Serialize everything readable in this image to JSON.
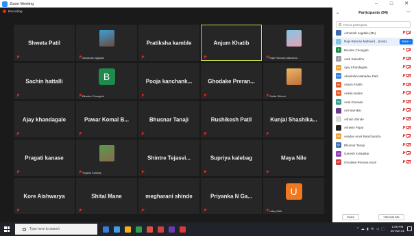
{
  "window": {
    "title": "Zoom Meeting",
    "controls": [
      "–",
      "□",
      "✕"
    ]
  },
  "recording": {
    "label": "Recording",
    "color": "#e02828"
  },
  "tiles": [
    {
      "name": "Shweta Patil",
      "label": "",
      "type": "name"
    },
    {
      "name": "",
      "label": "Ashutosh Jagdale",
      "type": "photo",
      "photo_colors": [
        "#3aa0d8",
        "#6b4a3a"
      ]
    },
    {
      "name": "Pratiksha kamble",
      "label": "",
      "type": "name"
    },
    {
      "name": "Anjum Khatib",
      "label": "",
      "type": "name",
      "active": true
    },
    {
      "name": "",
      "label": "Raje Ramrao Mahavid...",
      "type": "photo",
      "photo_colors": [
        "#7fc7e8",
        "#e8a0b0"
      ]
    },
    {
      "name": "Sachin hattalli",
      "label": "",
      "type": "name"
    },
    {
      "name": "",
      "label": "Birudev Chougule",
      "type": "letter",
      "letter": "B",
      "letter_color": "#1f8a4c"
    },
    {
      "name": "Pooja kanchank...",
      "label": "",
      "type": "name"
    },
    {
      "name": "Ghodake Preran...",
      "label": "",
      "type": "name"
    },
    {
      "name": "",
      "label": "Smita Shinde",
      "type": "photo",
      "photo_colors": [
        "#e8b860",
        "#c07040"
      ]
    },
    {
      "name": "Ajay khandagale",
      "label": "",
      "type": "name"
    },
    {
      "name": "Pawar Komal B...",
      "label": "",
      "type": "name"
    },
    {
      "name": "Bhusnar Tanaji",
      "label": "",
      "type": "name"
    },
    {
      "name": "Rushikesh Patil",
      "label": "",
      "type": "name"
    },
    {
      "name": "Kunjal Shashika...",
      "label": "",
      "type": "name"
    },
    {
      "name": "Pragati kanase",
      "label": "",
      "type": "name"
    },
    {
      "name": "",
      "label": "Yogesh Kolekar",
      "type": "photo",
      "photo_colors": [
        "#5a9a4a",
        "#8a6a50"
      ]
    },
    {
      "name": "Shintre Tejasvi...",
      "label": "",
      "type": "name"
    },
    {
      "name": "Supriya kalebag",
      "label": "",
      "type": "name"
    },
    {
      "name": "Maya Nile",
      "label": "",
      "type": "name"
    },
    {
      "name": "Kore Aishwarya",
      "label": "",
      "type": "name"
    },
    {
      "name": "Shital Mane",
      "label": "",
      "type": "name"
    },
    {
      "name": "megharani shinde",
      "label": "",
      "type": "name"
    },
    {
      "name": "Priyanka N Ga...",
      "label": "",
      "type": "name"
    },
    {
      "name": "",
      "label": "Uday Mali",
      "type": "letter",
      "letter": "U",
      "letter_color": "#f07820"
    }
  ],
  "participants_panel": {
    "title": "Participants (94)",
    "search_placeholder": "Find a participant",
    "more_button": "More ›",
    "invite_label": "Invite",
    "unmute_label": "Unmute Me",
    "participants": [
      {
        "name": "Ashutosh Jagdale (Me)",
        "initials": "",
        "color": "#3a6ab0",
        "mic": "muted",
        "video": "off"
      },
      {
        "name": "Raje Ramrao Mahavid... (Host)",
        "initials": "",
        "color": "#7fc7e8",
        "mic": "",
        "video": "",
        "highlight": true
      },
      {
        "name": "Birudev Chougule",
        "initials": "B",
        "color": "#1f8a4c",
        "mic": "grey",
        "video": "off"
      },
      {
        "name": "Aarti Salunkhe",
        "initials": "A",
        "color": "#9aa0a6",
        "mic": "muted",
        "video": "off"
      },
      {
        "name": "Ajay Khandagale",
        "initials": "AK",
        "color": "#f0a030",
        "mic": "muted",
        "video": "off"
      },
      {
        "name": "Akanksha Mahadev Patil",
        "initials": "AM",
        "color": "#2d7ad8",
        "mic": "muted",
        "video": "off"
      },
      {
        "name": "Anjum Khatib",
        "initials": "AK",
        "color": "#e05a2a",
        "mic": "muted",
        "video": "off"
      },
      {
        "name": "Ankita kadam",
        "initials": "AK",
        "color": "#e05a2a",
        "mic": "muted",
        "video": "off"
      },
      {
        "name": "Arati Kharade",
        "initials": "AK",
        "color": "#2aa08a",
        "mic": "muted",
        "video": "off"
      },
      {
        "name": "Arti Narnikar",
        "initials": "",
        "color": "#6a3a8a",
        "mic": "muted",
        "video": "off"
      },
      {
        "name": "Ashish Shinde",
        "initials": "",
        "color": "#d8d8d8",
        "mic": "muted",
        "video": "off"
      },
      {
        "name": "Ashwini Pujari",
        "initials": "",
        "color": "#222222",
        "mic": "muted",
        "video": "off"
      },
      {
        "name": "Avadan Amol Ramchandra",
        "initials": "AA",
        "color": "#f0a030",
        "mic": "muted",
        "video": "off"
      },
      {
        "name": "Bhusnar Tanaji",
        "initials": "BT",
        "color": "#3a6ab0",
        "mic": "muted",
        "video": "off"
      },
      {
        "name": "Ganesh Kolanjikar",
        "initials": "GK",
        "color": "#8a3ab0",
        "mic": "muted",
        "video": "off"
      },
      {
        "name": "Ghodake Prerana Sunil",
        "initials": "GP",
        "color": "#d03a3a",
        "mic": "muted",
        "video": "off"
      }
    ]
  },
  "taskbar": {
    "search_placeholder": "Type here to search",
    "tray_icons": "^ ☁ ▮ ✉ ◁ ⬚",
    "time": "1:06 PM",
    "date": "25-Jun-21",
    "app_colors": [
      "#3a7ad8",
      "#3aa0e8",
      "#f0b020",
      "#2aa050",
      "#e05040",
      "#d04040",
      "#6a3ab0",
      "#d83a3a"
    ]
  }
}
